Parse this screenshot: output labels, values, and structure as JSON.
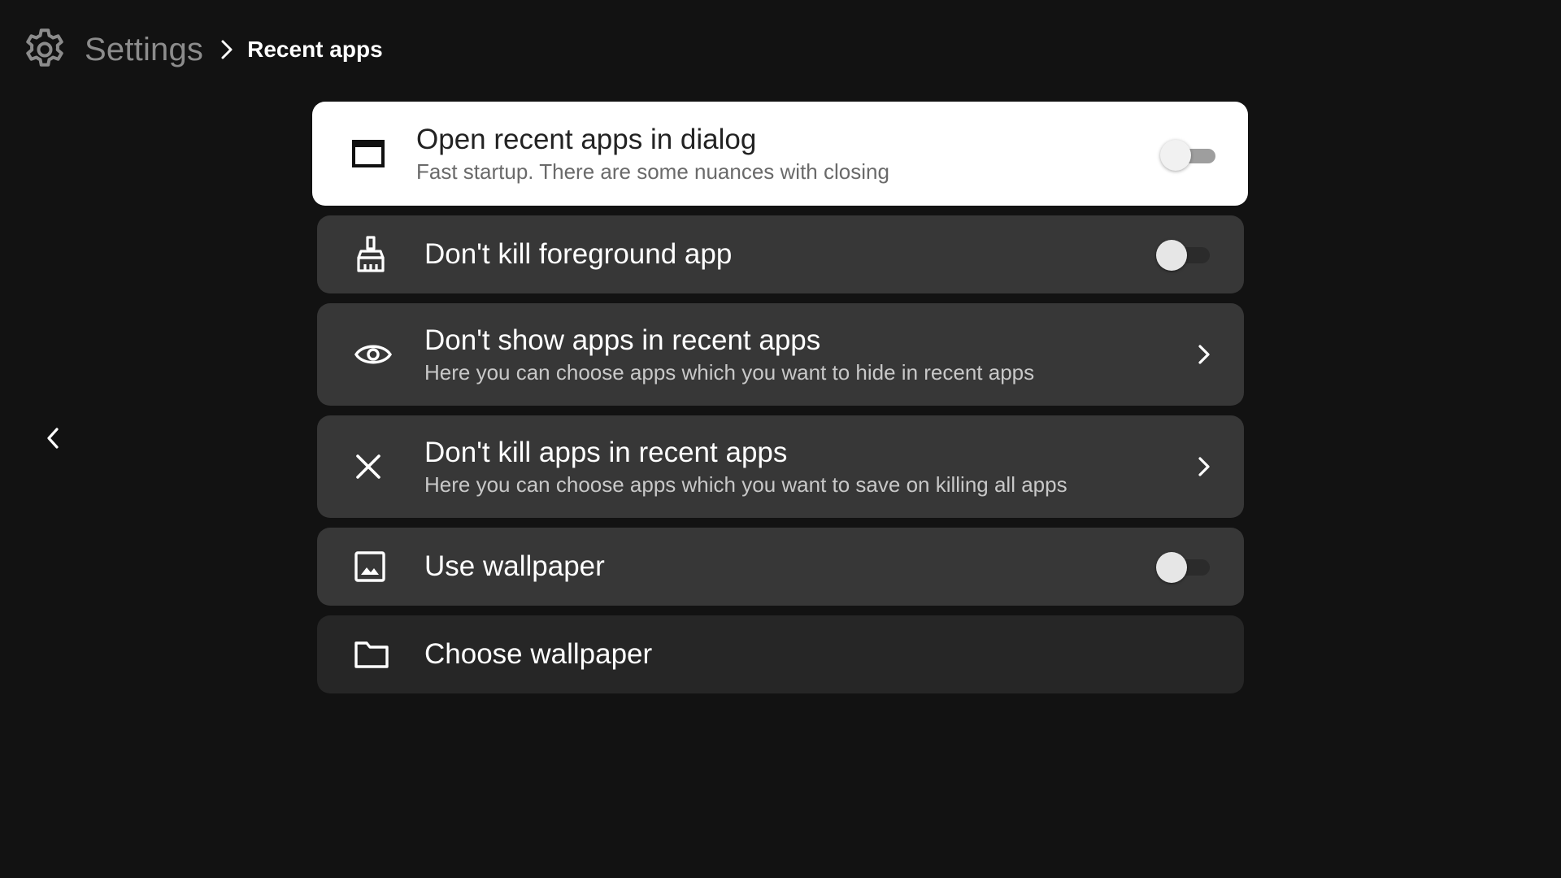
{
  "header": {
    "title": "Settings",
    "breadcrumb": "Recent apps",
    "icon": "gear-icon"
  },
  "items": [
    {
      "icon": "window-icon",
      "title": "Open recent apps in dialog",
      "subtitle": "Fast startup. There are some nuances with closing",
      "control": "toggle",
      "checked": false,
      "focused": true
    },
    {
      "icon": "broom-icon",
      "title": "Don't kill foreground app",
      "subtitle": "",
      "control": "toggle",
      "checked": false
    },
    {
      "icon": "eye-icon",
      "title": "Don't show apps in recent apps",
      "subtitle": "Here you can choose apps which you want to hide in recent apps",
      "control": "chevron"
    },
    {
      "icon": "close-icon",
      "title": "Don't kill apps in recent apps",
      "subtitle": "Here you can choose apps which you want to save on killing all apps",
      "control": "chevron"
    },
    {
      "icon": "image-icon",
      "title": "Use wallpaper",
      "subtitle": "",
      "control": "toggle",
      "checked": false
    },
    {
      "icon": "folder-icon",
      "title": "Choose wallpaper",
      "subtitle": "",
      "control": "none"
    }
  ],
  "nav": {
    "back_icon": "chevron-left-icon"
  },
  "colors": {
    "background": "#121212",
    "card": "#373737",
    "card_alt": "#262626",
    "focused_card": "#ffffff"
  }
}
